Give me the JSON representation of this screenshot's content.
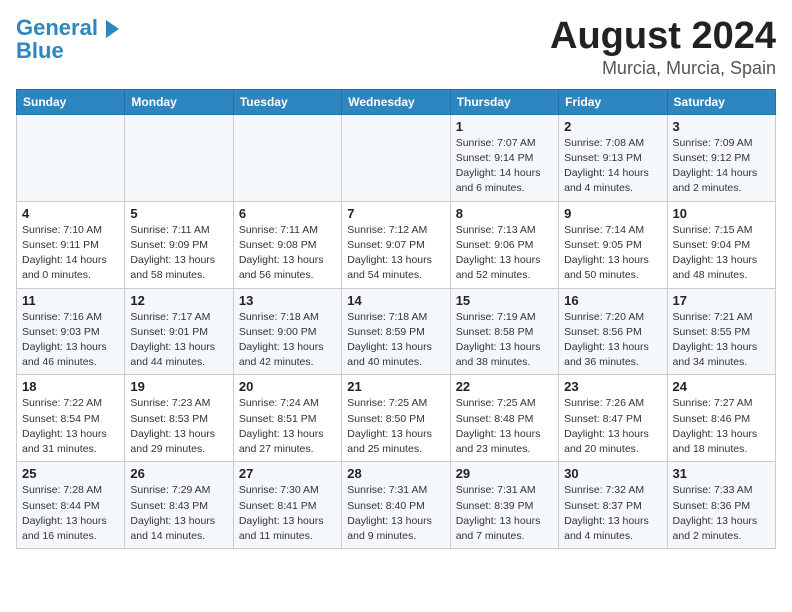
{
  "logo": {
    "line1": "General",
    "line2": "Blue"
  },
  "title": "August 2024",
  "subtitle": "Murcia, Murcia, Spain",
  "days_of_week": [
    "Sunday",
    "Monday",
    "Tuesday",
    "Wednesday",
    "Thursday",
    "Friday",
    "Saturday"
  ],
  "weeks": [
    [
      {
        "num": "",
        "info": ""
      },
      {
        "num": "",
        "info": ""
      },
      {
        "num": "",
        "info": ""
      },
      {
        "num": "",
        "info": ""
      },
      {
        "num": "1",
        "info": "Sunrise: 7:07 AM\nSunset: 9:14 PM\nDaylight: 14 hours\nand 6 minutes."
      },
      {
        "num": "2",
        "info": "Sunrise: 7:08 AM\nSunset: 9:13 PM\nDaylight: 14 hours\nand 4 minutes."
      },
      {
        "num": "3",
        "info": "Sunrise: 7:09 AM\nSunset: 9:12 PM\nDaylight: 14 hours\nand 2 minutes."
      }
    ],
    [
      {
        "num": "4",
        "info": "Sunrise: 7:10 AM\nSunset: 9:11 PM\nDaylight: 14 hours\nand 0 minutes."
      },
      {
        "num": "5",
        "info": "Sunrise: 7:11 AM\nSunset: 9:09 PM\nDaylight: 13 hours\nand 58 minutes."
      },
      {
        "num": "6",
        "info": "Sunrise: 7:11 AM\nSunset: 9:08 PM\nDaylight: 13 hours\nand 56 minutes."
      },
      {
        "num": "7",
        "info": "Sunrise: 7:12 AM\nSunset: 9:07 PM\nDaylight: 13 hours\nand 54 minutes."
      },
      {
        "num": "8",
        "info": "Sunrise: 7:13 AM\nSunset: 9:06 PM\nDaylight: 13 hours\nand 52 minutes."
      },
      {
        "num": "9",
        "info": "Sunrise: 7:14 AM\nSunset: 9:05 PM\nDaylight: 13 hours\nand 50 minutes."
      },
      {
        "num": "10",
        "info": "Sunrise: 7:15 AM\nSunset: 9:04 PM\nDaylight: 13 hours\nand 48 minutes."
      }
    ],
    [
      {
        "num": "11",
        "info": "Sunrise: 7:16 AM\nSunset: 9:03 PM\nDaylight: 13 hours\nand 46 minutes."
      },
      {
        "num": "12",
        "info": "Sunrise: 7:17 AM\nSunset: 9:01 PM\nDaylight: 13 hours\nand 44 minutes."
      },
      {
        "num": "13",
        "info": "Sunrise: 7:18 AM\nSunset: 9:00 PM\nDaylight: 13 hours\nand 42 minutes."
      },
      {
        "num": "14",
        "info": "Sunrise: 7:18 AM\nSunset: 8:59 PM\nDaylight: 13 hours\nand 40 minutes."
      },
      {
        "num": "15",
        "info": "Sunrise: 7:19 AM\nSunset: 8:58 PM\nDaylight: 13 hours\nand 38 minutes."
      },
      {
        "num": "16",
        "info": "Sunrise: 7:20 AM\nSunset: 8:56 PM\nDaylight: 13 hours\nand 36 minutes."
      },
      {
        "num": "17",
        "info": "Sunrise: 7:21 AM\nSunset: 8:55 PM\nDaylight: 13 hours\nand 34 minutes."
      }
    ],
    [
      {
        "num": "18",
        "info": "Sunrise: 7:22 AM\nSunset: 8:54 PM\nDaylight: 13 hours\nand 31 minutes."
      },
      {
        "num": "19",
        "info": "Sunrise: 7:23 AM\nSunset: 8:53 PM\nDaylight: 13 hours\nand 29 minutes."
      },
      {
        "num": "20",
        "info": "Sunrise: 7:24 AM\nSunset: 8:51 PM\nDaylight: 13 hours\nand 27 minutes."
      },
      {
        "num": "21",
        "info": "Sunrise: 7:25 AM\nSunset: 8:50 PM\nDaylight: 13 hours\nand 25 minutes."
      },
      {
        "num": "22",
        "info": "Sunrise: 7:25 AM\nSunset: 8:48 PM\nDaylight: 13 hours\nand 23 minutes."
      },
      {
        "num": "23",
        "info": "Sunrise: 7:26 AM\nSunset: 8:47 PM\nDaylight: 13 hours\nand 20 minutes."
      },
      {
        "num": "24",
        "info": "Sunrise: 7:27 AM\nSunset: 8:46 PM\nDaylight: 13 hours\nand 18 minutes."
      }
    ],
    [
      {
        "num": "25",
        "info": "Sunrise: 7:28 AM\nSunset: 8:44 PM\nDaylight: 13 hours\nand 16 minutes."
      },
      {
        "num": "26",
        "info": "Sunrise: 7:29 AM\nSunset: 8:43 PM\nDaylight: 13 hours\nand 14 minutes."
      },
      {
        "num": "27",
        "info": "Sunrise: 7:30 AM\nSunset: 8:41 PM\nDaylight: 13 hours\nand 11 minutes."
      },
      {
        "num": "28",
        "info": "Sunrise: 7:31 AM\nSunset: 8:40 PM\nDaylight: 13 hours\nand 9 minutes."
      },
      {
        "num": "29",
        "info": "Sunrise: 7:31 AM\nSunset: 8:39 PM\nDaylight: 13 hours\nand 7 minutes."
      },
      {
        "num": "30",
        "info": "Sunrise: 7:32 AM\nSunset: 8:37 PM\nDaylight: 13 hours\nand 4 minutes."
      },
      {
        "num": "31",
        "info": "Sunrise: 7:33 AM\nSunset: 8:36 PM\nDaylight: 13 hours\nand 2 minutes."
      }
    ]
  ]
}
